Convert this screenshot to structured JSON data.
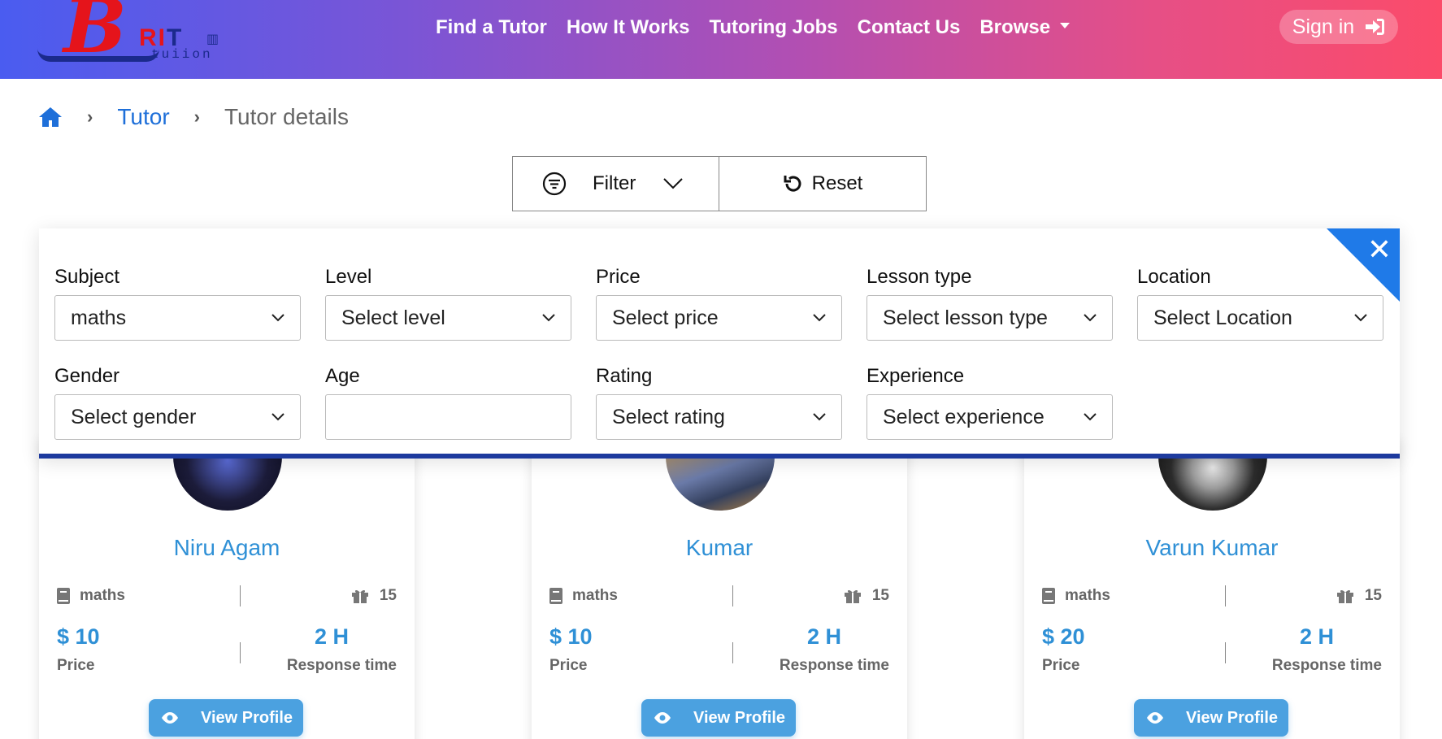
{
  "header": {
    "logo": {
      "letter": "B",
      "rit": "RI",
      "t": "T",
      "tuition": "tuiion"
    },
    "nav": [
      "Find a Tutor",
      "How It Works",
      "Tutoring Jobs",
      "Contact Us",
      "Browse"
    ],
    "sign_in": "Sign in"
  },
  "breadcrumb": {
    "items": [
      "Tutor",
      "Tutor details"
    ]
  },
  "filter_bar": {
    "filter_label": "Filter",
    "reset_label": "Reset"
  },
  "filters": {
    "subject": {
      "label": "Subject",
      "value": "maths"
    },
    "level": {
      "label": "Level",
      "value": "Select level"
    },
    "price": {
      "label": "Price",
      "value": "Select price"
    },
    "lesson_type": {
      "label": "Lesson type",
      "value": "Select lesson type"
    },
    "location": {
      "label": "Location",
      "value": "Select Location"
    },
    "gender": {
      "label": "Gender",
      "value": "Select gender"
    },
    "age": {
      "label": "Age",
      "value": ""
    },
    "rating": {
      "label": "Rating",
      "value": "Select rating"
    },
    "experience": {
      "label": "Experience",
      "value": "Select experience"
    }
  },
  "cards": [
    {
      "name": "Niru Agam",
      "subject": "maths",
      "count": "15",
      "price": "$ 10",
      "price_label": "Price",
      "response": "2 H",
      "response_label": "Response time",
      "button": "View Profile"
    },
    {
      "name": "Kumar",
      "subject": "maths",
      "count": "15",
      "price": "$ 10",
      "price_label": "Price",
      "response": "2 H",
      "response_label": "Response time",
      "button": "View Profile"
    },
    {
      "name": "Varun Kumar",
      "subject": "maths",
      "count": "15",
      "price": "$ 20",
      "price_label": "Price",
      "response": "2 H",
      "response_label": "Response time",
      "button": "View Profile"
    }
  ],
  "colors": {
    "accent": "#2f90d6",
    "button": "#4ba1e0",
    "close": "#1f7ae8",
    "panel_border": "#1d3a9e"
  }
}
